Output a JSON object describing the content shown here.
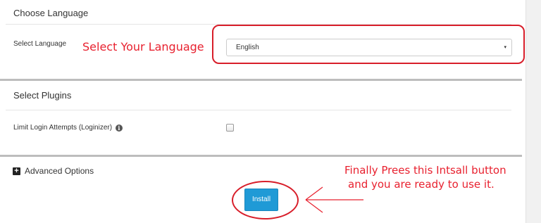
{
  "language_section": {
    "title": "Choose Language",
    "field_label": "Select Language",
    "selected_language": "English",
    "caret": "▾"
  },
  "plugins_section": {
    "title": "Select Plugins",
    "plugin_label": "Limit Login Attempts (Loginizer)",
    "info_glyph": "i",
    "checked": false
  },
  "advanced": {
    "label": "Advanced Options",
    "toggle_glyph": "+"
  },
  "install": {
    "label": "Install"
  },
  "annotations": {
    "language": "Select Your Language",
    "install_line1": "Finally Prees this Intsall button",
    "install_line2": "and you are ready to use it.",
    "color": "#e8212f"
  },
  "colors": {
    "accent_button": "#1f9ad6",
    "annotation_red": "#d81e2a"
  }
}
